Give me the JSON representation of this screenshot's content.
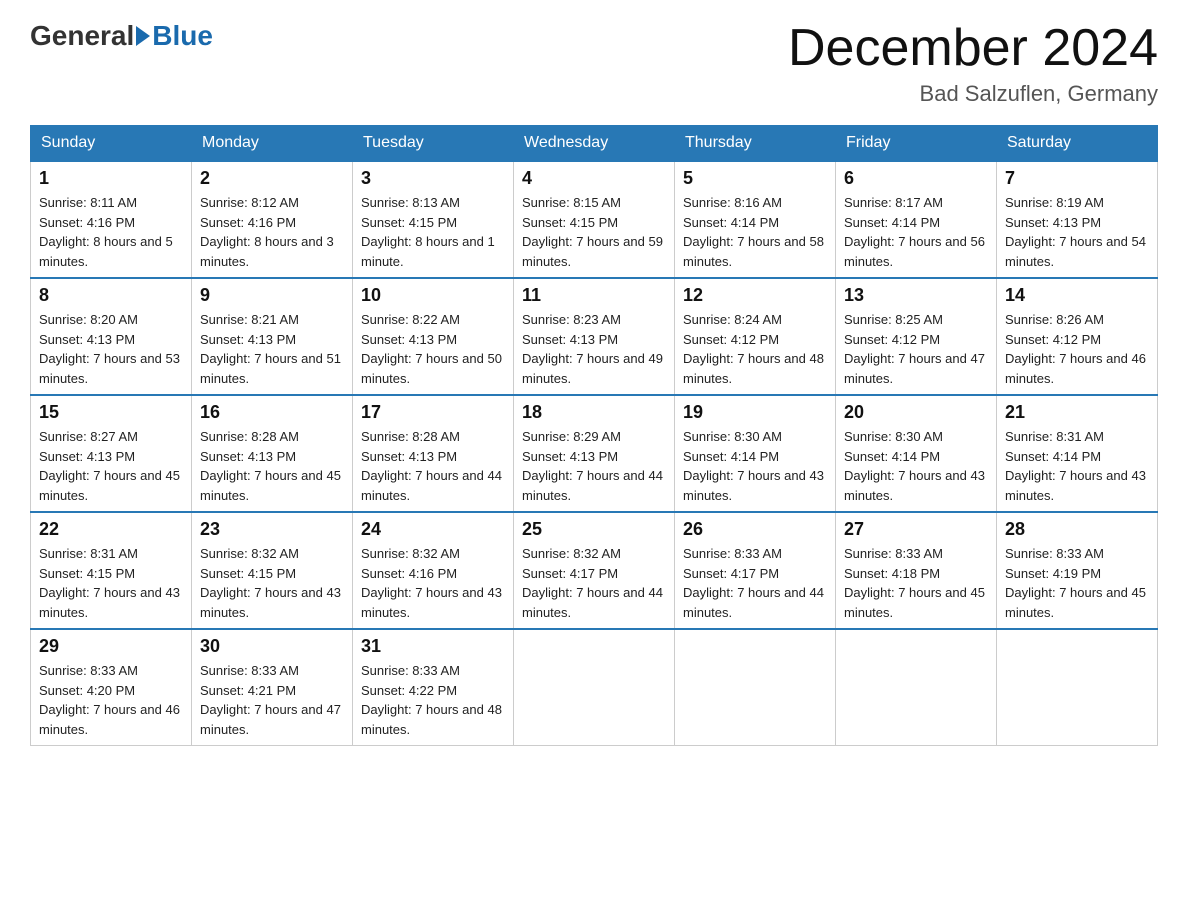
{
  "header": {
    "logo": {
      "general": "General",
      "blue": "Blue"
    },
    "title": "December 2024",
    "location": "Bad Salzuflen, Germany"
  },
  "calendar": {
    "weekdays": [
      "Sunday",
      "Monday",
      "Tuesday",
      "Wednesday",
      "Thursday",
      "Friday",
      "Saturday"
    ],
    "weeks": [
      [
        {
          "day": 1,
          "sunrise": "8:11 AM",
          "sunset": "4:16 PM",
          "daylight": "8 hours and 5 minutes."
        },
        {
          "day": 2,
          "sunrise": "8:12 AM",
          "sunset": "4:16 PM",
          "daylight": "8 hours and 3 minutes."
        },
        {
          "day": 3,
          "sunrise": "8:13 AM",
          "sunset": "4:15 PM",
          "daylight": "8 hours and 1 minute."
        },
        {
          "day": 4,
          "sunrise": "8:15 AM",
          "sunset": "4:15 PM",
          "daylight": "7 hours and 59 minutes."
        },
        {
          "day": 5,
          "sunrise": "8:16 AM",
          "sunset": "4:14 PM",
          "daylight": "7 hours and 58 minutes."
        },
        {
          "day": 6,
          "sunrise": "8:17 AM",
          "sunset": "4:14 PM",
          "daylight": "7 hours and 56 minutes."
        },
        {
          "day": 7,
          "sunrise": "8:19 AM",
          "sunset": "4:13 PM",
          "daylight": "7 hours and 54 minutes."
        }
      ],
      [
        {
          "day": 8,
          "sunrise": "8:20 AM",
          "sunset": "4:13 PM",
          "daylight": "7 hours and 53 minutes."
        },
        {
          "day": 9,
          "sunrise": "8:21 AM",
          "sunset": "4:13 PM",
          "daylight": "7 hours and 51 minutes."
        },
        {
          "day": 10,
          "sunrise": "8:22 AM",
          "sunset": "4:13 PM",
          "daylight": "7 hours and 50 minutes."
        },
        {
          "day": 11,
          "sunrise": "8:23 AM",
          "sunset": "4:13 PM",
          "daylight": "7 hours and 49 minutes."
        },
        {
          "day": 12,
          "sunrise": "8:24 AM",
          "sunset": "4:12 PM",
          "daylight": "7 hours and 48 minutes."
        },
        {
          "day": 13,
          "sunrise": "8:25 AM",
          "sunset": "4:12 PM",
          "daylight": "7 hours and 47 minutes."
        },
        {
          "day": 14,
          "sunrise": "8:26 AM",
          "sunset": "4:12 PM",
          "daylight": "7 hours and 46 minutes."
        }
      ],
      [
        {
          "day": 15,
          "sunrise": "8:27 AM",
          "sunset": "4:13 PM",
          "daylight": "7 hours and 45 minutes."
        },
        {
          "day": 16,
          "sunrise": "8:28 AM",
          "sunset": "4:13 PM",
          "daylight": "7 hours and 45 minutes."
        },
        {
          "day": 17,
          "sunrise": "8:28 AM",
          "sunset": "4:13 PM",
          "daylight": "7 hours and 44 minutes."
        },
        {
          "day": 18,
          "sunrise": "8:29 AM",
          "sunset": "4:13 PM",
          "daylight": "7 hours and 44 minutes."
        },
        {
          "day": 19,
          "sunrise": "8:30 AM",
          "sunset": "4:14 PM",
          "daylight": "7 hours and 43 minutes."
        },
        {
          "day": 20,
          "sunrise": "8:30 AM",
          "sunset": "4:14 PM",
          "daylight": "7 hours and 43 minutes."
        },
        {
          "day": 21,
          "sunrise": "8:31 AM",
          "sunset": "4:14 PM",
          "daylight": "7 hours and 43 minutes."
        }
      ],
      [
        {
          "day": 22,
          "sunrise": "8:31 AM",
          "sunset": "4:15 PM",
          "daylight": "7 hours and 43 minutes."
        },
        {
          "day": 23,
          "sunrise": "8:32 AM",
          "sunset": "4:15 PM",
          "daylight": "7 hours and 43 minutes."
        },
        {
          "day": 24,
          "sunrise": "8:32 AM",
          "sunset": "4:16 PM",
          "daylight": "7 hours and 43 minutes."
        },
        {
          "day": 25,
          "sunrise": "8:32 AM",
          "sunset": "4:17 PM",
          "daylight": "7 hours and 44 minutes."
        },
        {
          "day": 26,
          "sunrise": "8:33 AM",
          "sunset": "4:17 PM",
          "daylight": "7 hours and 44 minutes."
        },
        {
          "day": 27,
          "sunrise": "8:33 AM",
          "sunset": "4:18 PM",
          "daylight": "7 hours and 45 minutes."
        },
        {
          "day": 28,
          "sunrise": "8:33 AM",
          "sunset": "4:19 PM",
          "daylight": "7 hours and 45 minutes."
        }
      ],
      [
        {
          "day": 29,
          "sunrise": "8:33 AM",
          "sunset": "4:20 PM",
          "daylight": "7 hours and 46 minutes."
        },
        {
          "day": 30,
          "sunrise": "8:33 AM",
          "sunset": "4:21 PM",
          "daylight": "7 hours and 47 minutes."
        },
        {
          "day": 31,
          "sunrise": "8:33 AM",
          "sunset": "4:22 PM",
          "daylight": "7 hours and 48 minutes."
        },
        null,
        null,
        null,
        null
      ]
    ]
  }
}
